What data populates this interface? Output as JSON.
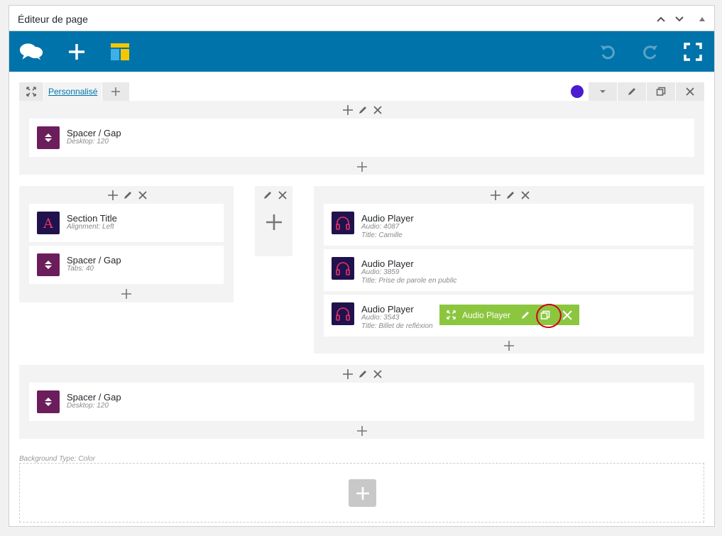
{
  "postbox": {
    "title": "Éditeur de page"
  },
  "section1": {
    "tab_label": "Personnalisé",
    "color": "#4a1bd1",
    "elements": [
      {
        "title": "Spacer / Gap",
        "sub": "Desktop: 120",
        "icon": "updown-arrow-icon"
      }
    ]
  },
  "section2": {
    "col1": [
      {
        "title": "Section Title",
        "sub": "Alignment: Left",
        "icon": "letter-a-icon"
      },
      {
        "title": "Spacer / Gap",
        "sub": "Tabs: 40",
        "icon": "updown-arrow-icon"
      }
    ],
    "col3": [
      {
        "title": "Audio Player",
        "sub1": "Audio: 4087",
        "sub2": "Title: Camille",
        "icon": "headphones-icon"
      },
      {
        "title": "Audio Player",
        "sub1": "Audio: 3859",
        "sub2": "Title: Prise de parole en public",
        "icon": "headphones-icon"
      },
      {
        "title": "Audio Player",
        "sub1": "Audio: 3543",
        "sub2": "Title: Billet de refléxion",
        "icon": "headphones-icon"
      }
    ],
    "hover_bar_label": "Audio Player"
  },
  "section3": {
    "elements": [
      {
        "title": "Spacer / Gap",
        "sub": "Desktop: 120",
        "icon": "updown-arrow-icon"
      }
    ]
  },
  "section4": {
    "background_type": "Background Type: Color"
  },
  "colors": {
    "toolbar": "#0073aa",
    "hover_bar": "#8cc63f",
    "elem_purple": "#6b1d5c",
    "elem_navy": "#20124d",
    "accent_pink": "#e8336b"
  }
}
